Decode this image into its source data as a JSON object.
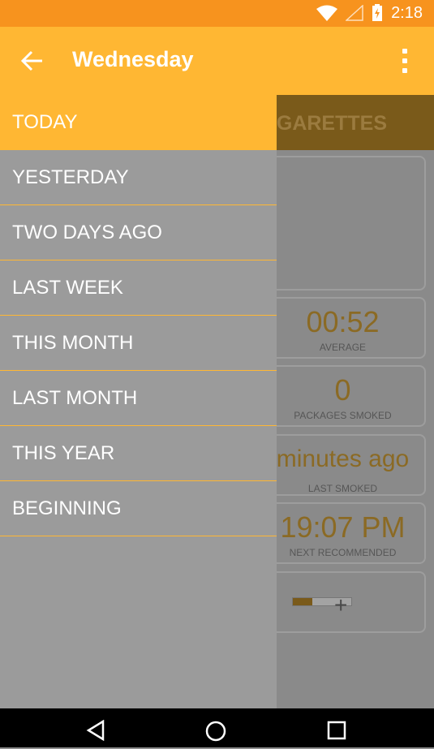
{
  "status_bar": {
    "time": "2:18"
  },
  "app_bar": {
    "title": "Wednesday"
  },
  "background": {
    "tab_label": "CIGARETTES",
    "cards": [
      {
        "value": "00:52",
        "label": "AVERAGE"
      },
      {
        "value": "0",
        "label": "PACKAGES SMOKED"
      },
      {
        "value": "minutes ago",
        "label": "LAST SMOKED"
      },
      {
        "value": "19:07 PM",
        "label": "NEXT RECOMMENDED"
      }
    ],
    "progress_fraction": 0.33
  },
  "drawer": {
    "items": [
      {
        "label": "TODAY"
      },
      {
        "label": "YESTERDAY"
      },
      {
        "label": "TWO DAYS AGO"
      },
      {
        "label": "LAST WEEK"
      },
      {
        "label": "THIS MONTH"
      },
      {
        "label": "LAST MONTH"
      },
      {
        "label": "THIS YEAR"
      },
      {
        "label": "BEGINNING"
      }
    ],
    "selected_index": 0
  },
  "colors": {
    "accent": "#ffb733",
    "status": "#f7931e",
    "drawer": "#9b9b9b"
  },
  "icons": {
    "back": "arrow-left-icon",
    "menu": "more-vert-icon",
    "wifi": "wifi-icon",
    "signal": "signal-icon",
    "battery": "battery-charging-icon",
    "nav_back": "triangle-back-icon",
    "nav_home": "circle-home-icon",
    "nav_recents": "square-recents-icon"
  }
}
